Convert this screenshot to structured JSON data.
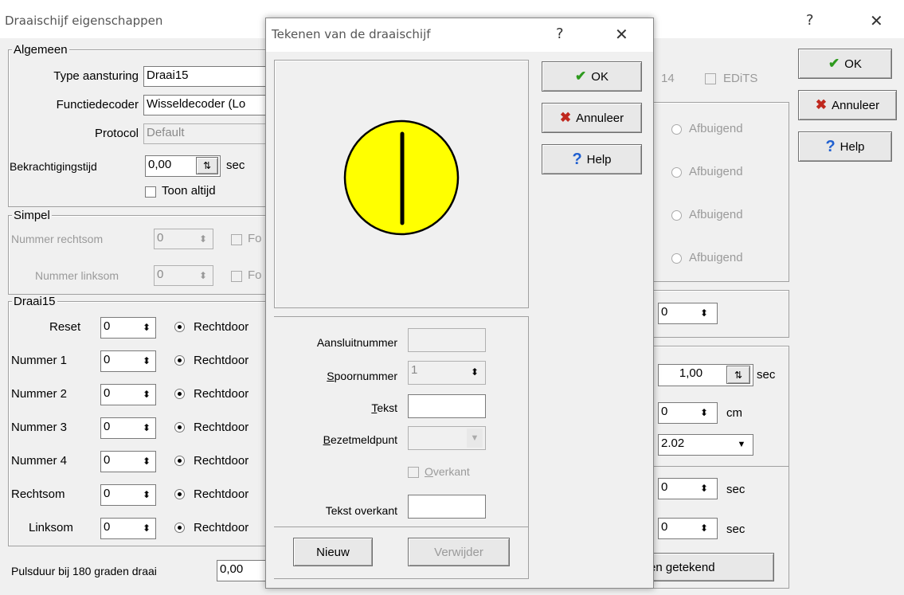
{
  "main": {
    "title": "Draaischijf eigenschappen",
    "help": "?",
    "close": "✕",
    "ok_label": "OK",
    "cancel_label": "Annuleer",
    "help_label": "Help",
    "groups": {
      "algemeen": "Algemeen",
      "simpel": "Simpel",
      "draai": "Draai15"
    },
    "type_label": "Type aansturing",
    "type_value": "Draai15",
    "decoder_label": "Functiedecoder",
    "decoder_value": "Wisseldecoder (Lo",
    "protocol_label": "Protocol",
    "protocol_value": "Default",
    "bekr_label": "Bekrachtigingstijd",
    "bekr_value": "0,00",
    "bekr_unit": "sec",
    "toon_label": "Toon altijd",
    "nr_rechtsom_label": "Nummer rechtsom",
    "nr_rechtsom_value": "0",
    "nr_linksom_label": "Nummer linksom",
    "nr_linksom_value": "0",
    "fo_label": "Fo",
    "draai_rows": [
      {
        "label": "Reset",
        "value": "0",
        "radio": "Rechtdoor"
      },
      {
        "label": "Nummer 1",
        "value": "0",
        "radio": "Rechtdoor"
      },
      {
        "label": "Nummer 2",
        "value": "0",
        "radio": "Rechtdoor"
      },
      {
        "label": "Nummer 3",
        "value": "0",
        "radio": "Rechtdoor"
      },
      {
        "label": "Nummer 4",
        "value": "0",
        "radio": "Rechtdoor"
      },
      {
        "label": "Rechtsom",
        "value": "0",
        "radio": "Rechtdoor"
      },
      {
        "label": "Linksom",
        "value": "0",
        "radio": "Rechtdoor"
      }
    ],
    "puls_label": "Pulsduur bij 180 graden draai",
    "puls_value": "0,00",
    "right": {
      "num14": "14",
      "edits": "EDiTS",
      "afbuigend": [
        "Afbuigend",
        "Afbuigend",
        "Afbuigend",
        "Afbuigend"
      ],
      "spin0": "0",
      "time_value": "1,00",
      "time_unit": "sec",
      "cm_value": "0",
      "cm_unit": "cm",
      "version": "2.02",
      "sec1_value": "0",
      "sec1_unit": "sec",
      "sec2_value": "0",
      "sec2_unit": "sec",
      "getekend": "en getekend"
    }
  },
  "dialog": {
    "title": "Tekenen van de draaischijf",
    "help": "?",
    "close": "✕",
    "ok_label": "OK",
    "cancel_label": "Annuleer",
    "help_label": "Help",
    "aansluit_label": "Aansluitnummer",
    "aansluit_value": "",
    "spoor_label": "Spoornummer",
    "spoor_value": "1",
    "tekst_label": "Tekst",
    "tekst_value": "",
    "bezet_label": "Bezetmeldpunt",
    "bezet_value": "",
    "overkant_label": "Overkant",
    "tekst_overkant_label": "Tekst overkant",
    "tekst_overkant_value": "",
    "nieuw_label": "Nieuw",
    "verwijder_label": "Verwijder"
  },
  "colors": {
    "turntable_fill": "#ffff00",
    "ok_check": "#2e9a1e",
    "cancel_x": "#c0281e",
    "help_q": "#1f5fd0"
  }
}
